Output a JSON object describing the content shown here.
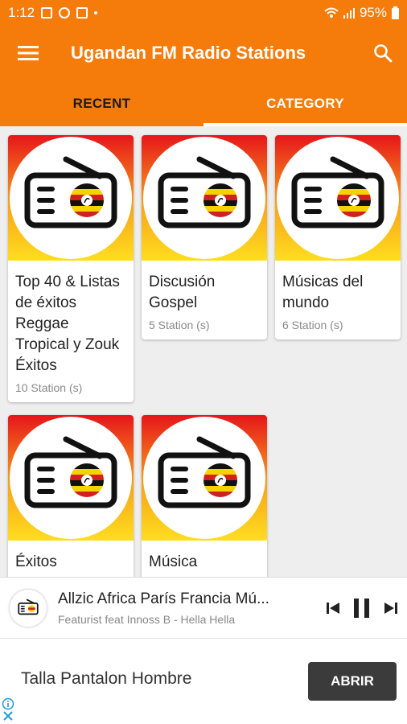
{
  "status": {
    "time": "1:12",
    "battery": "95%"
  },
  "appbar": {
    "title": "Ugandan FM Radio Stations",
    "menu_icon": "menu-icon",
    "search_icon": "search-icon"
  },
  "tabs": [
    {
      "label": "RECENT",
      "active": false
    },
    {
      "label": "CATEGORY",
      "active": true
    }
  ],
  "categories": [
    {
      "name": "Top 40 & Listas de éxitos Reggae Tropical y Zouk Éxitos",
      "count": "10 Station (s)"
    },
    {
      "name": "Discusión Gospel",
      "count": "5 Station (s)"
    },
    {
      "name": "Músicas del mundo",
      "count": "6 Station (s)"
    },
    {
      "name": "Éxitos",
      "count": ""
    },
    {
      "name": "Música",
      "count": ""
    }
  ],
  "player": {
    "title": "Allzic Africa París Francia Mú...",
    "subtitle": "Featurist  feat Innoss B  -  Hella Hella"
  },
  "ad": {
    "text": "Talla Pantalon Hombre",
    "button": "ABRIR"
  },
  "colors": {
    "primary": "#f57c0b",
    "flag_black": "#111111",
    "flag_yellow": "#f6d200",
    "flag_red": "#d21f1f"
  }
}
